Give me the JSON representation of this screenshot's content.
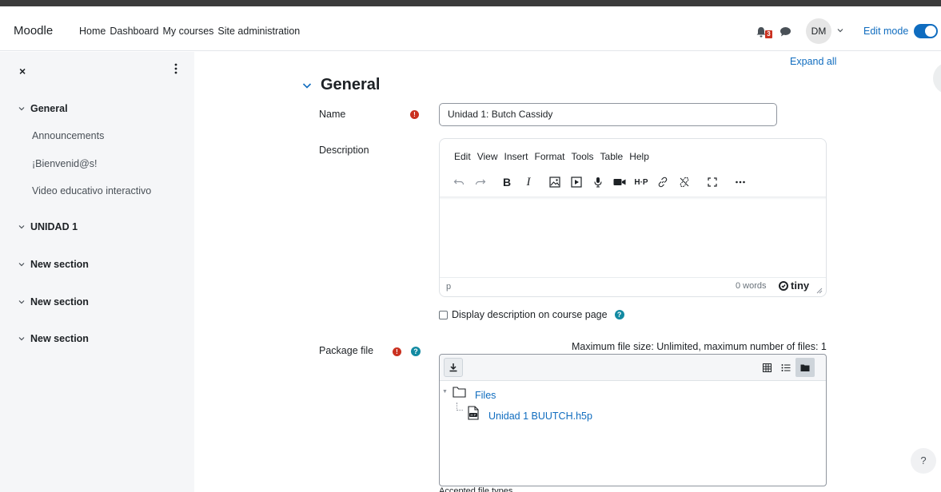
{
  "navbar": {
    "brand": "Moodle",
    "links": [
      "Home",
      "Dashboard",
      "My courses",
      "Site administration"
    ],
    "notification_count": "3",
    "avatar_initials": "DM",
    "edit_mode_label": "Edit mode",
    "edit_mode_on": true
  },
  "drawer": {
    "close_symbol": "×",
    "sections": [
      {
        "label": "General",
        "activities": [
          "Announcements",
          "¡Bienvenid@s!",
          "Video educativo interactivo"
        ]
      },
      {
        "label": "UNIDAD 1",
        "activities": []
      },
      {
        "label": "New section",
        "activities": []
      },
      {
        "label": "New section",
        "activities": []
      },
      {
        "label": "New section",
        "activities": []
      }
    ]
  },
  "main": {
    "expand_all": "Expand all",
    "section_title": "General",
    "name_label": "Name",
    "name_value": "Unidad 1: Butch Cassidy",
    "description_label": "Description",
    "editor": {
      "menus": [
        "Edit",
        "View",
        "Insert",
        "Format",
        "Tools",
        "Table",
        "Help"
      ],
      "status_path": "p",
      "word_count": "0 words",
      "brand": "tiny"
    },
    "display_description_label": "Display description on course page",
    "package_file_label": "Package file",
    "max_size_text": "Maximum file size: Unlimited, maximum number of files: 1",
    "file_tree": {
      "folder": "Files",
      "file": "Unidad 1 BUUTCH.h5p"
    },
    "accepted_types_label": "Accepted file types",
    "help_button": "?"
  },
  "colors": {
    "accent": "#0f6cbf",
    "required": "#ca3120",
    "help": "#128aa2"
  }
}
